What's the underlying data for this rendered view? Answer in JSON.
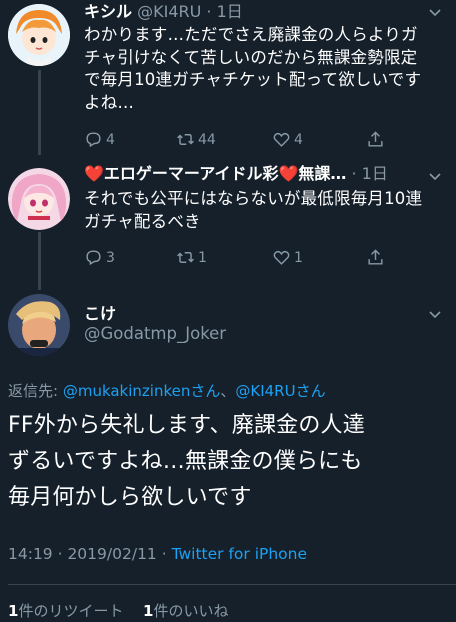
{
  "colors": {
    "background": "#15202b",
    "secondary_text": "#8899a6",
    "link": "#1da1f2",
    "divider": "#38444d",
    "heart": "#e0245e"
  },
  "replies": [
    {
      "name": "キシル",
      "handle": "@KI4RU",
      "time": "1日",
      "text_lines": [
        "わかります…ただでさえ廃課金の人らよりガ",
        "チャ引けなくて苦しいのだから無課金勢限定",
        "で毎月10連ガチャチケット配って欲しいです",
        "よね…"
      ],
      "reply_count": "4",
      "retweet_count": "44",
      "like_count": "4"
    },
    {
      "name": "❤️エロゲーマーアイドル彩❤️無課…",
      "handle": "",
      "time": "1日",
      "text_lines": [
        "それでも公平にはならないが最低限毎月10連",
        "ガチャ配るべき"
      ],
      "reply_count": "3",
      "retweet_count": "1",
      "like_count": "1"
    }
  ],
  "main_tweet": {
    "name": "こけ",
    "handle": "@Godatmp_Joker",
    "reply_to_prefix": "返信先: ",
    "reply_to_link1": "@mukakinzinkenさん",
    "reply_to_sep": "、",
    "reply_to_link2": "@KI4RUさん",
    "text_lines": [
      "FF外から失礼します、廃課金の人達",
      "ずるいですよね…無課金の僕らにも",
      "毎月何かしら欲しいです"
    ],
    "timestamp": "14:19 · 2019/02/11 · ",
    "source": "Twitter for iPhone",
    "retweet_count": "1",
    "retweet_label": "件のリツイート",
    "like_count": "1",
    "like_label": "件のいいね"
  }
}
